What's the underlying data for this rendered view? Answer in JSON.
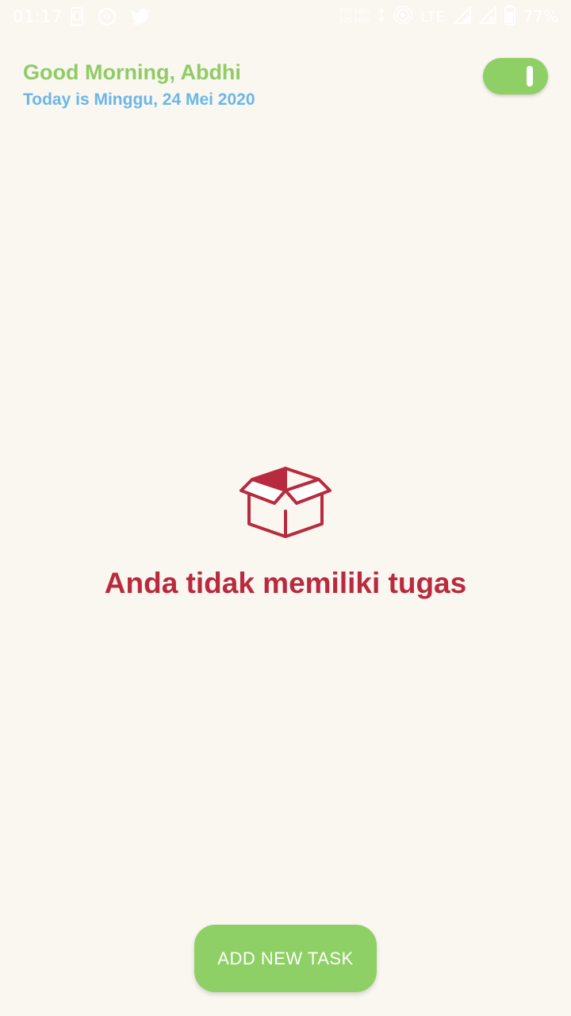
{
  "status_bar": {
    "time": "01:17",
    "net_speed_up": "370 kB/s",
    "net_speed_down": "325 kB/s",
    "network_type": "LTE",
    "battery_percent": "77%",
    "left_icons": [
      "screenshot-icon",
      "sync-icon",
      "twitter-icon"
    ],
    "right_icons": [
      "data-arrows-icon",
      "hotspot-icon",
      "signal-icon",
      "signal-x-icon",
      "battery-icon"
    ]
  },
  "header": {
    "greeting": "Good Morning, Abdhi",
    "date_text": "Today is Minggu, 24 Mei 2020",
    "toggle_state": "on"
  },
  "empty_state": {
    "icon": "open-box-icon",
    "message": "Anda tidak memiliki tugas"
  },
  "actions": {
    "add_task_label": "ADD NEW TASK"
  },
  "colors": {
    "background": "#faf6f0",
    "greeting": "#8fcc66",
    "date": "#6ab7e8",
    "accent_green": "#8fd066",
    "empty_red": "#b82a3e"
  }
}
